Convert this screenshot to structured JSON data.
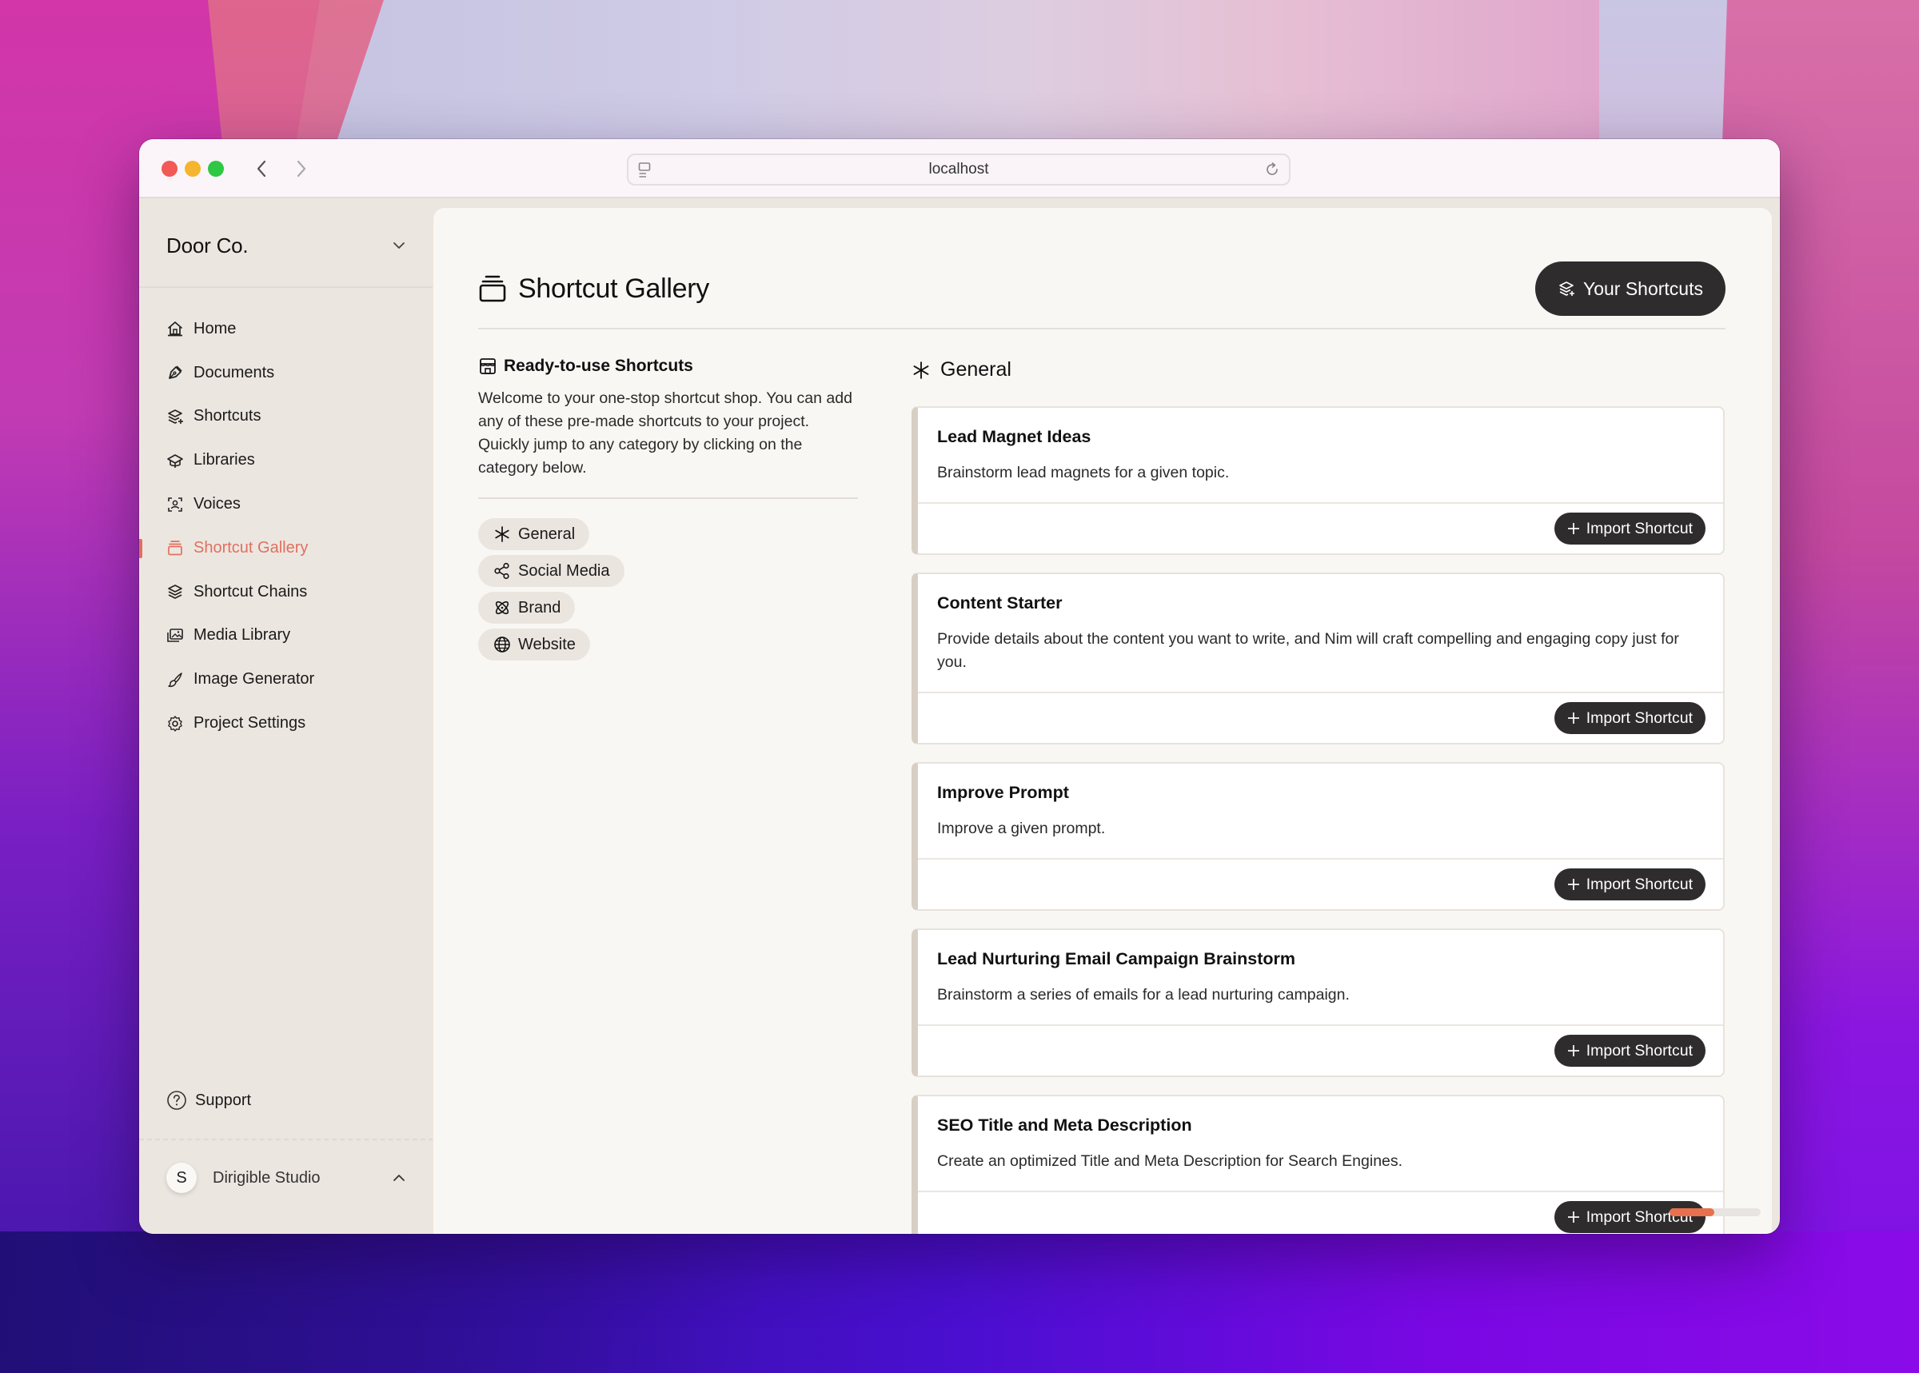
{
  "browser": {
    "url": "localhost"
  },
  "sidebar": {
    "workspace": "Door Co.",
    "items": [
      {
        "label": "Home",
        "icon": "home-icon",
        "active": false
      },
      {
        "label": "Documents",
        "icon": "pen-nib-icon",
        "active": false
      },
      {
        "label": "Shortcuts",
        "icon": "layers-plus-icon",
        "active": false
      },
      {
        "label": "Libraries",
        "icon": "graduation-cap-icon",
        "active": false
      },
      {
        "label": "Voices",
        "icon": "user-scan-icon",
        "active": false
      },
      {
        "label": "Shortcut Gallery",
        "icon": "gallery-stack-icon",
        "active": true
      },
      {
        "label": "Shortcut Chains",
        "icon": "layers-icon",
        "active": false
      },
      {
        "label": "Media Library",
        "icon": "images-icon",
        "active": false
      },
      {
        "label": "Image Generator",
        "icon": "brush-icon",
        "active": false
      },
      {
        "label": "Project Settings",
        "icon": "gear-icon",
        "active": false
      }
    ],
    "support": "Support",
    "user": {
      "initial": "S",
      "name": "Dirigible Studio"
    }
  },
  "header": {
    "title": "Shortcut Gallery",
    "your_shortcuts": "Your Shortcuts"
  },
  "intro": {
    "title": "Ready-to-use Shortcuts",
    "text": "Welcome to your one-stop shortcut shop. You can add any of these pre-made shortcuts to your project. Quickly jump to any category by clicking on the category below."
  },
  "categories": [
    {
      "label": "General",
      "icon": "asterisk-icon"
    },
    {
      "label": "Social Media",
      "icon": "share-icon"
    },
    {
      "label": "Brand",
      "icon": "atom-icon"
    },
    {
      "label": "Website",
      "icon": "globe-icon"
    }
  ],
  "section": {
    "title": "General"
  },
  "cards": [
    {
      "title": "Lead Magnet Ideas",
      "desc": "Brainstorm lead magnets for a given topic.",
      "button": "Import Shortcut"
    },
    {
      "title": "Content Starter",
      "desc": "Provide details about the content you want to write, and Nim will craft compelling and engaging copy just for you.",
      "button": "Import Shortcut"
    },
    {
      "title": "Improve Prompt",
      "desc": "Improve a given prompt.",
      "button": "Import Shortcut"
    },
    {
      "title": "Lead Nurturing Email Campaign Brainstorm",
      "desc": "Brainstorm a series of emails for a lead nurturing campaign.",
      "button": "Import Shortcut"
    },
    {
      "title": "SEO Title and Meta Description",
      "desc": "Create an optimized Title and Meta Description for Search Engines.",
      "button": "Import Shortcut"
    }
  ],
  "colors": {
    "accent": "#e07060",
    "dark_button": "#2f2c2e",
    "sidebar_bg": "#ece6e0",
    "main_bg": "#f9f7f4"
  },
  "scroll": {
    "horizontal_position": 0.0
  }
}
